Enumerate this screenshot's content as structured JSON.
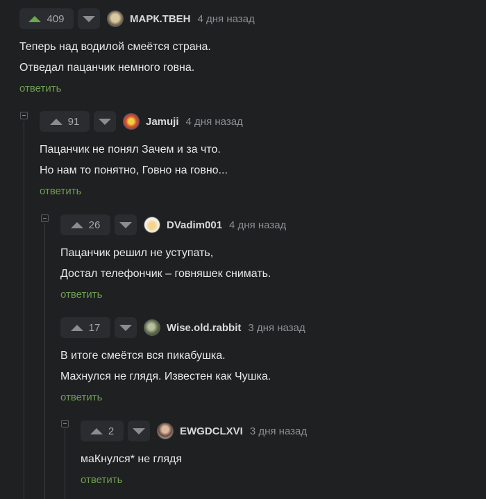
{
  "comments": [
    {
      "votes": "409",
      "author": "МАРК.ТВЕН",
      "time": "4 дня назад",
      "avatar": "mark-twain-avatar",
      "lines": [
        "Теперь над водилой смеётся страна.",
        "Отведал пацанчик немного говна."
      ],
      "reply": "ответить"
    },
    {
      "votes": "91",
      "author": "Jamuji",
      "time": "4 дня назад",
      "avatar": "jamuji-avatar",
      "lines": [
        "Пацанчик не понял Зачем и за что.",
        "Но нам то понятно, Говно на говно..."
      ],
      "reply": "ответить"
    },
    {
      "votes": "26",
      "author": "DVadim001",
      "time": "4 дня назад",
      "avatar": "dvadim-avatar",
      "lines": [
        "Пацанчик решил не уступать,",
        "Достал телефончик – говняшек снимать."
      ],
      "reply": "ответить"
    },
    {
      "votes": "17",
      "author": "Wise.old.rabbit",
      "time": "3 дня назад",
      "avatar": "rabbit-avatar",
      "lines": [
        "В итоге смеётся вся пикабушка.",
        "Махнулся не глядя. Известен как Чушка."
      ],
      "reply": "ответить"
    },
    {
      "votes": "2",
      "author": "EWGDCLXVI",
      "time": "3 дня назад",
      "avatar": "ewgdclxvi-avatar",
      "lines": [
        "маКнулся* не глядя"
      ],
      "reply": "ответить"
    }
  ],
  "colors": {
    "background": "#1f2022",
    "reply_link": "#6f9e52",
    "upvote_active": "#6aa84f"
  }
}
